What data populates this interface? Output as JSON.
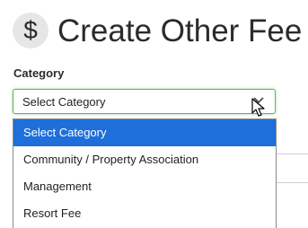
{
  "header": {
    "icon": "dollar-icon",
    "icon_glyph": "$",
    "title": "Create Other Fee"
  },
  "category": {
    "label": "Category",
    "selected": "Select Category",
    "options": [
      "Select Category",
      "Community / Property Association",
      "Management",
      "Resort Fee"
    ],
    "highlighted_index": 0
  },
  "colors": {
    "text": "#2b2b2b",
    "focus_border": "#5cb85c",
    "highlight": "#1e6fd9",
    "icon_bg": "#e6e6e6"
  }
}
